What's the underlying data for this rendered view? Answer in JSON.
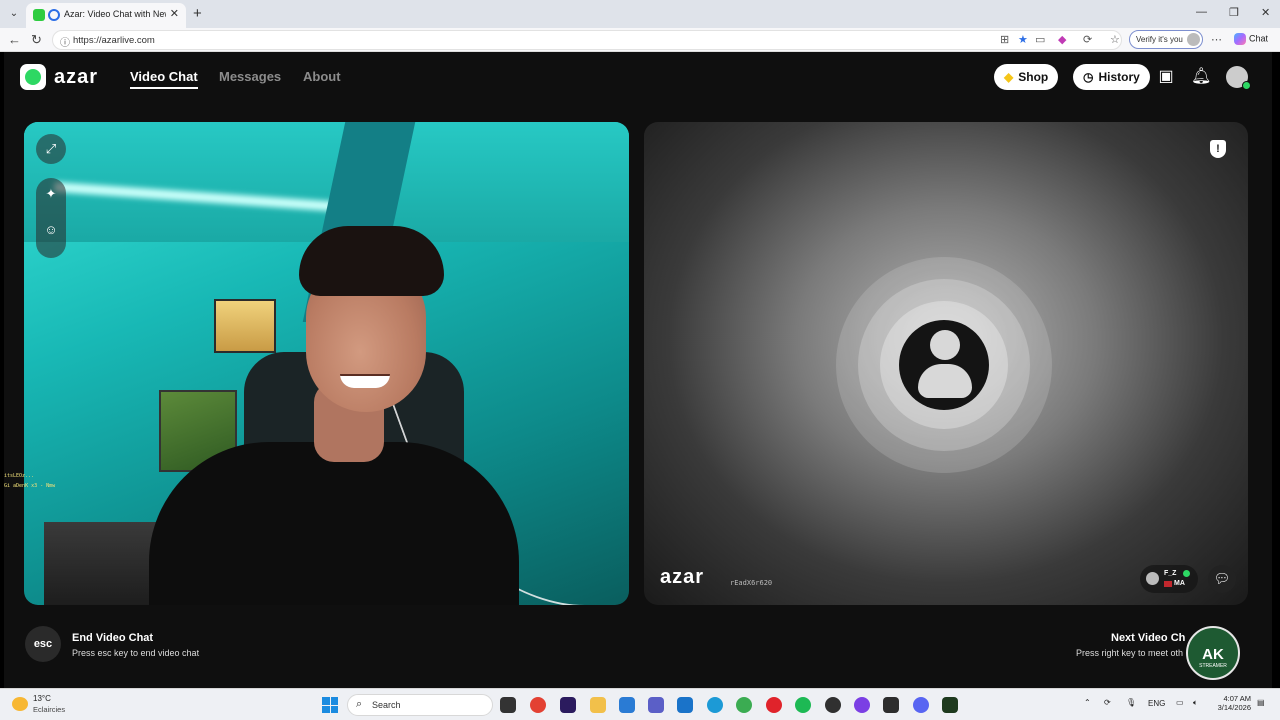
{
  "browser": {
    "tab_title": "Azar: Video Chat with New Pe",
    "url": "https://azarlive.com",
    "verify_label": "Verify it's you",
    "copilot_label": "Chat"
  },
  "app": {
    "logo_text": "azar",
    "nav": [
      {
        "label": "Video Chat",
        "active": true
      },
      {
        "label": "Messages",
        "active": false
      },
      {
        "label": "About",
        "active": false
      }
    ],
    "shop_label": "Shop",
    "history_label": "History"
  },
  "remote": {
    "watermark": "azar",
    "code": "rEadX6r620",
    "peer_name": "F_Z",
    "peer_country": "MA"
  },
  "bottom": {
    "esc_key": "esc",
    "end_title": "End Video Chat",
    "end_sub": "Press esc key to end video chat",
    "next_title": "Next Video Ch",
    "next_sub": "Press right key to meet oth",
    "badge_main": "AK",
    "badge_sub": "STREAMER"
  },
  "overlay": {
    "line1": "itsLEOz...",
    "line2": "Gi aDenK x3 - Nmw"
  },
  "taskbar": {
    "temp": "13°C",
    "condition": "Eclaircies",
    "search_placeholder": "Search",
    "lang": "ENG",
    "time": "4:07 AM",
    "date": "3/14/2026"
  },
  "colors": {
    "accent_green": "#2dd863",
    "app_bg": "#0f0f0f"
  }
}
